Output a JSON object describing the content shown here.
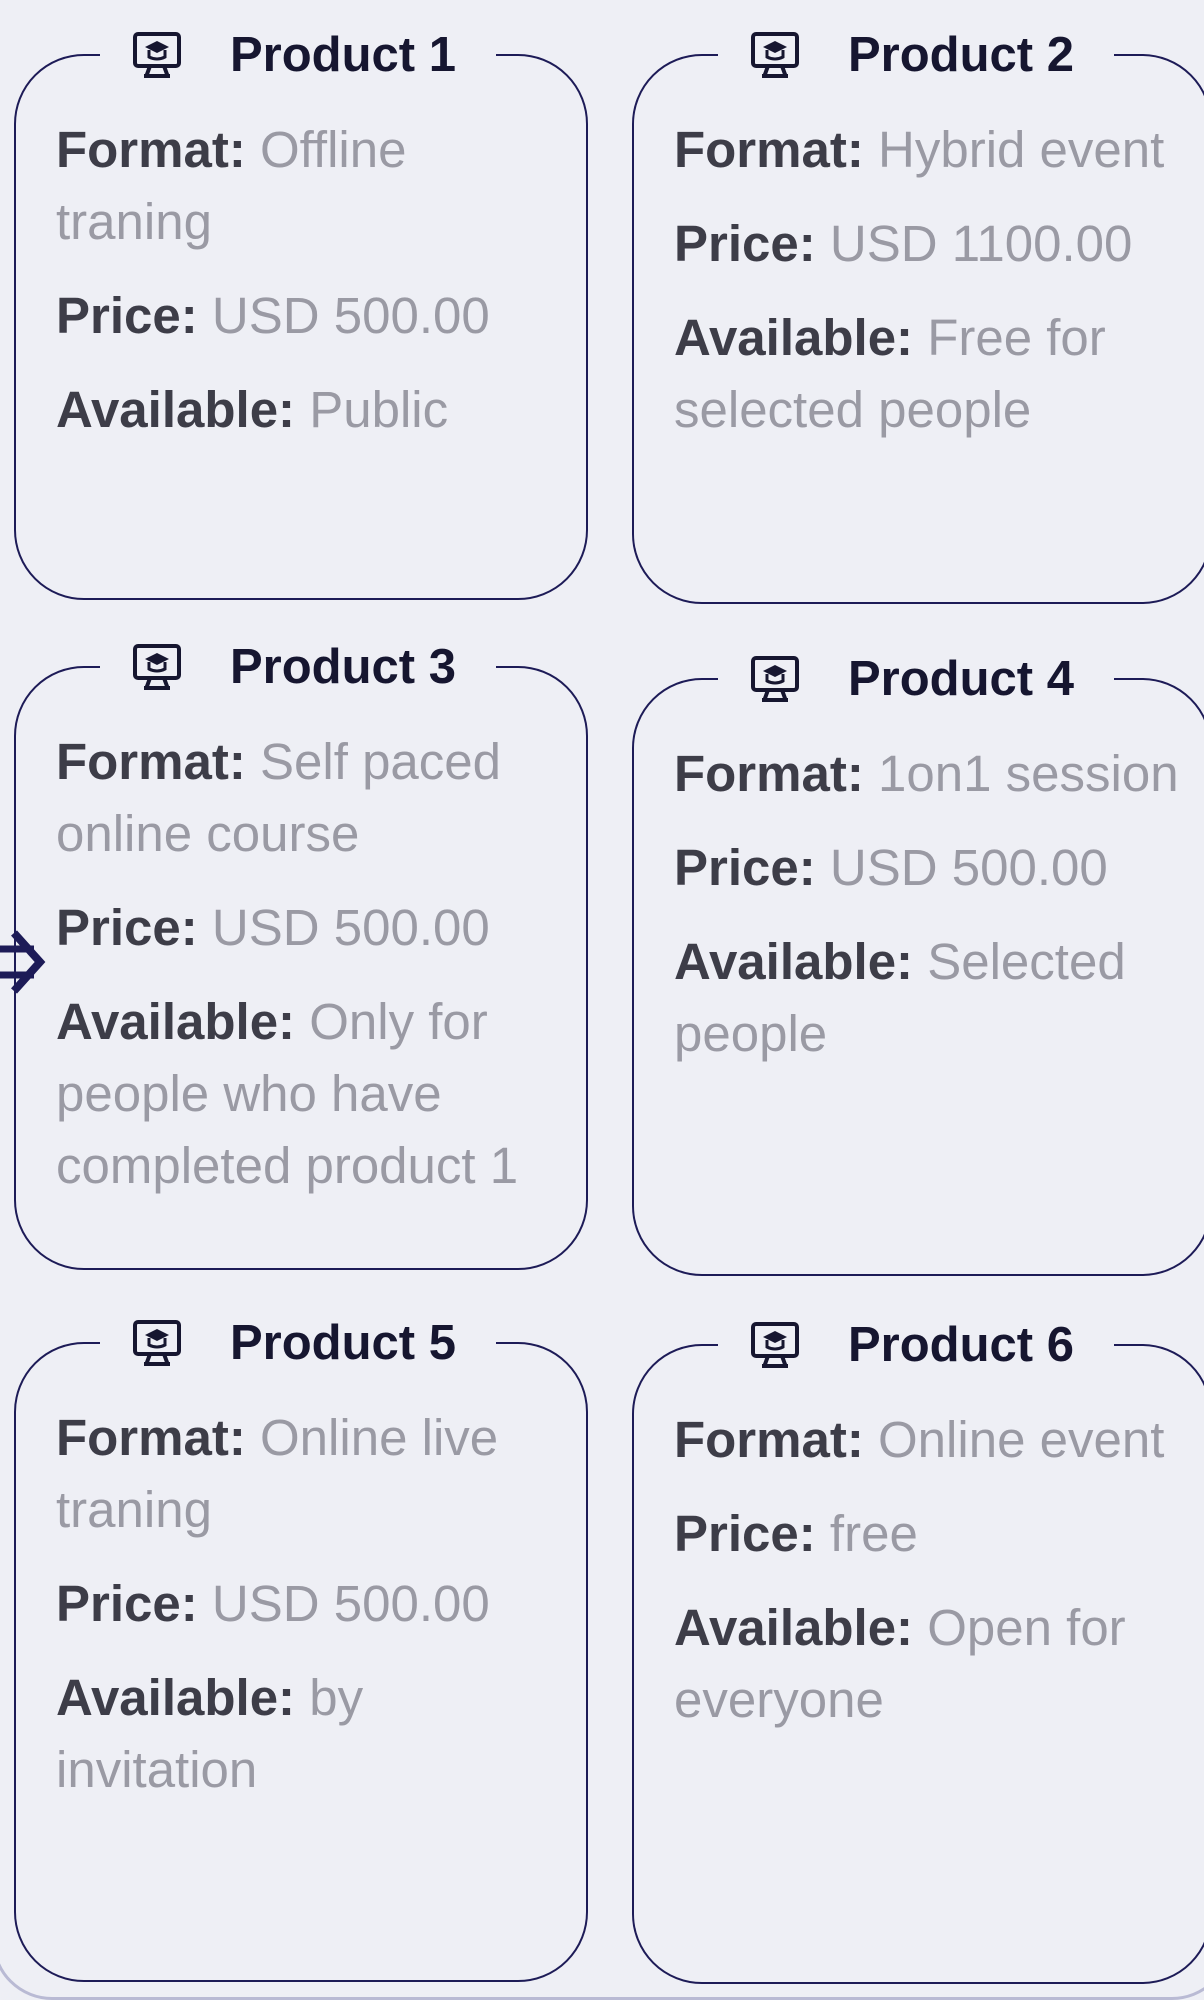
{
  "field_labels": {
    "format": "Format:",
    "price": "Price:",
    "available": "Available:"
  },
  "products": [
    {
      "title": "Product 1",
      "format": "Offline traning",
      "price": "USD 500.00",
      "available": "Public"
    },
    {
      "title": "Product 2",
      "format": "Hybrid event",
      "price": "USD 1100.00",
      "available": "Free for selected people"
    },
    {
      "title": "Product 3",
      "format": "Self paced online course",
      "price": "USD 500.00",
      "available": "Only for people who have completed product 1"
    },
    {
      "title": "Product 4",
      "format": "1on1 session",
      "price": "USD 500.00",
      "available": "Selected people"
    },
    {
      "title": "Product 5",
      "format": "Online live traning",
      "price": "USD 500.00",
      "available": "by invitation"
    },
    {
      "title": "Product 6",
      "format": "Online event",
      "price": "free",
      "available": "Open for everyone"
    }
  ],
  "icons": {
    "product": "online-course-monitor-icon",
    "connector": "arrow-right-icon"
  },
  "colors": {
    "card_border": "#1d1b57",
    "label": "#3d3d48",
    "value": "#9a9aa4",
    "background": "#eeeff5"
  }
}
